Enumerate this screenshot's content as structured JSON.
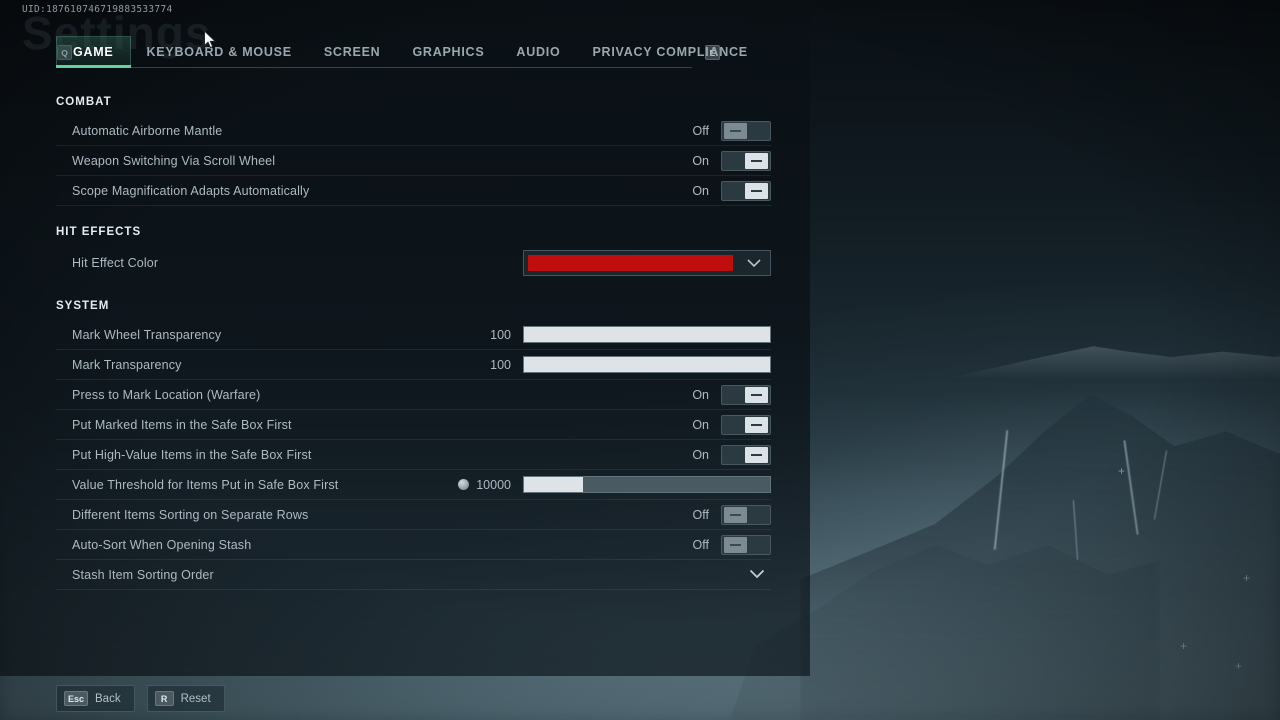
{
  "header": {
    "uid": "UID:187610746719883533774",
    "watermark_title": "Settings",
    "key_prev": "Q",
    "key_next": "E"
  },
  "tabs": [
    {
      "label": "GAME",
      "active": true
    },
    {
      "label": "KEYBOARD & MOUSE",
      "active": false
    },
    {
      "label": "SCREEN",
      "active": false
    },
    {
      "label": "GRAPHICS",
      "active": false
    },
    {
      "label": "AUDIO",
      "active": false
    },
    {
      "label": "PRIVACY COMPLIANCE",
      "active": false
    }
  ],
  "sections": {
    "combat": {
      "title": "COMBAT",
      "rows": [
        {
          "label": "Automatic Airborne Mantle",
          "value": "Off"
        },
        {
          "label": "Weapon Switching Via Scroll Wheel",
          "value": "On"
        },
        {
          "label": "Scope Magnification Adapts Automatically",
          "value": "On"
        }
      ]
    },
    "hit_effects": {
      "title": "HIT EFFECTS",
      "rows": [
        {
          "label": "Hit Effect Color",
          "color": "#c00d0d"
        }
      ]
    },
    "system": {
      "title": "SYSTEM",
      "rows": [
        {
          "label": "Mark Wheel Transparency",
          "value": "100",
          "fill_percent": 100
        },
        {
          "label": "Mark Transparency",
          "value": "100",
          "fill_percent": 100
        },
        {
          "label": "Press to Mark Location (Warfare)",
          "value": "On"
        },
        {
          "label": "Put Marked Items in the Safe Box First",
          "value": "On"
        },
        {
          "label": "Put High-Value Items in the Safe Box First",
          "value": "On"
        },
        {
          "label": "Value Threshold for Items Put in Safe Box First",
          "value": "10000",
          "fill_percent": 24
        },
        {
          "label": "Different Items Sorting on Separate Rows",
          "value": "Off"
        },
        {
          "label": "Auto-Sort When Opening Stash",
          "value": "Off"
        },
        {
          "label": "Stash Item Sorting Order",
          "value": ""
        }
      ]
    }
  },
  "footer": {
    "back_key": "Esc",
    "back_label": "Back",
    "reset_key": "R",
    "reset_label": "Reset"
  },
  "colors": {
    "accent": "#5fd39a",
    "hit_effect": "#c00d0d",
    "slider_fill": "#dde3e7"
  }
}
